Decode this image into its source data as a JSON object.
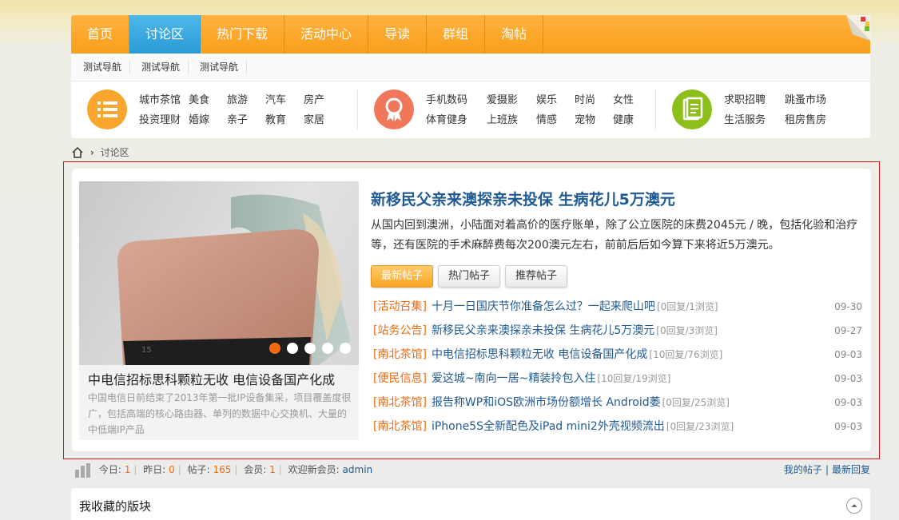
{
  "nav": {
    "items": [
      "首页",
      "讨论区",
      "热门下载",
      "活动中心",
      "导读",
      "群组",
      "淘帖"
    ],
    "active_index": 1
  },
  "subnav": [
    "测试导航",
    "测试导航",
    "测试导航"
  ],
  "categories": {
    "group1": {
      "row1": [
        "城市茶馆",
        "美食",
        "旅游",
        "汽车",
        "房产"
      ],
      "row2": [
        "投资理财",
        "婚嫁",
        "亲子",
        "教育",
        "家居"
      ],
      "icon": "list-icon",
      "color": "#f9a52e"
    },
    "group2": {
      "row1": [
        "手机数码",
        "爱摄影",
        "娱乐",
        "时尚",
        "女性"
      ],
      "row2": [
        "体育健身",
        "上班族",
        "情感",
        "宠物",
        "健康"
      ],
      "icon": "ribbon-icon",
      "color": "#f0775a"
    },
    "group3": {
      "row1": [
        "求职招聘",
        "跳蚤市场"
      ],
      "row2": [
        "生活服务",
        "租房售房"
      ],
      "icon": "document-icon",
      "color": "#8cbf1a"
    }
  },
  "breadcrumb": {
    "current": "讨论区",
    "home_icon": "home-icon"
  },
  "slider": {
    "title": "中电信招标思科颗粒无收 电信设备国产化成",
    "desc": "中国电信日前结束了2013年第一批IP设备集采，项目覆盖度很广，包括高端的核心路由器、单列的数据中心交换机、大量的中低端IP产品",
    "dot_count": 5,
    "active_dot": 0
  },
  "featured": {
    "title": "新移民父亲来澳探亲未投保 生病花儿5万澳元",
    "desc": "从国内回到澳洲，小陆面对着高价的医疗账单，除了公立医院的床费2045元 / 晚，包括化验和治疗等，还有医院的手术麻醉费每次200澳元左右，前前后后如今算下来将近5万澳元。"
  },
  "tabs": [
    "最新帖子",
    "热门帖子",
    "推荐帖子"
  ],
  "posts": [
    {
      "tag": "[活动召集]",
      "title": "十月一日国庆节你准备怎么过？一起来爬山吧",
      "meta": "[0回复/1浏览]",
      "date": "09-30"
    },
    {
      "tag": "[站务公告]",
      "title": "新移民父亲来澳探亲未投保 生病花儿5万澳元",
      "meta": "[0回复/3浏览]",
      "date": "09-27"
    },
    {
      "tag": "[南北茶馆]",
      "title": "中电信招标思科颗粒无收 电信设备国产化成",
      "meta": "[10回复/76浏览]",
      "date": "09-03"
    },
    {
      "tag": "[便民信息]",
      "title": "爱这城~南向一居~精装拎包入住",
      "meta": "[10回复/19浏览]",
      "date": "09-03"
    },
    {
      "tag": "[南北茶馆]",
      "title": "报告称WP和iOS欧洲市场份额增长 Android萎",
      "meta": "[0回复/25浏览]",
      "date": "09-03"
    },
    {
      "tag": "[南北茶馆]",
      "title": "iPhone5S全新配色及iPad mini2外壳视频流出",
      "meta": "[0回复/23浏览]",
      "date": "09-03"
    }
  ],
  "stats": {
    "today_label": "今日:",
    "today": "1",
    "yesterday_label": "昨日:",
    "yesterday": "0",
    "posts_label": "帖子:",
    "posts": "165",
    "members_label": "会员:",
    "members": "1",
    "welcome_label": "欢迎新会员:",
    "newest": "admin",
    "my_posts": "我的帖子",
    "latest_replies": "最新回复"
  },
  "favorites": {
    "title": "我收藏的版块"
  }
}
